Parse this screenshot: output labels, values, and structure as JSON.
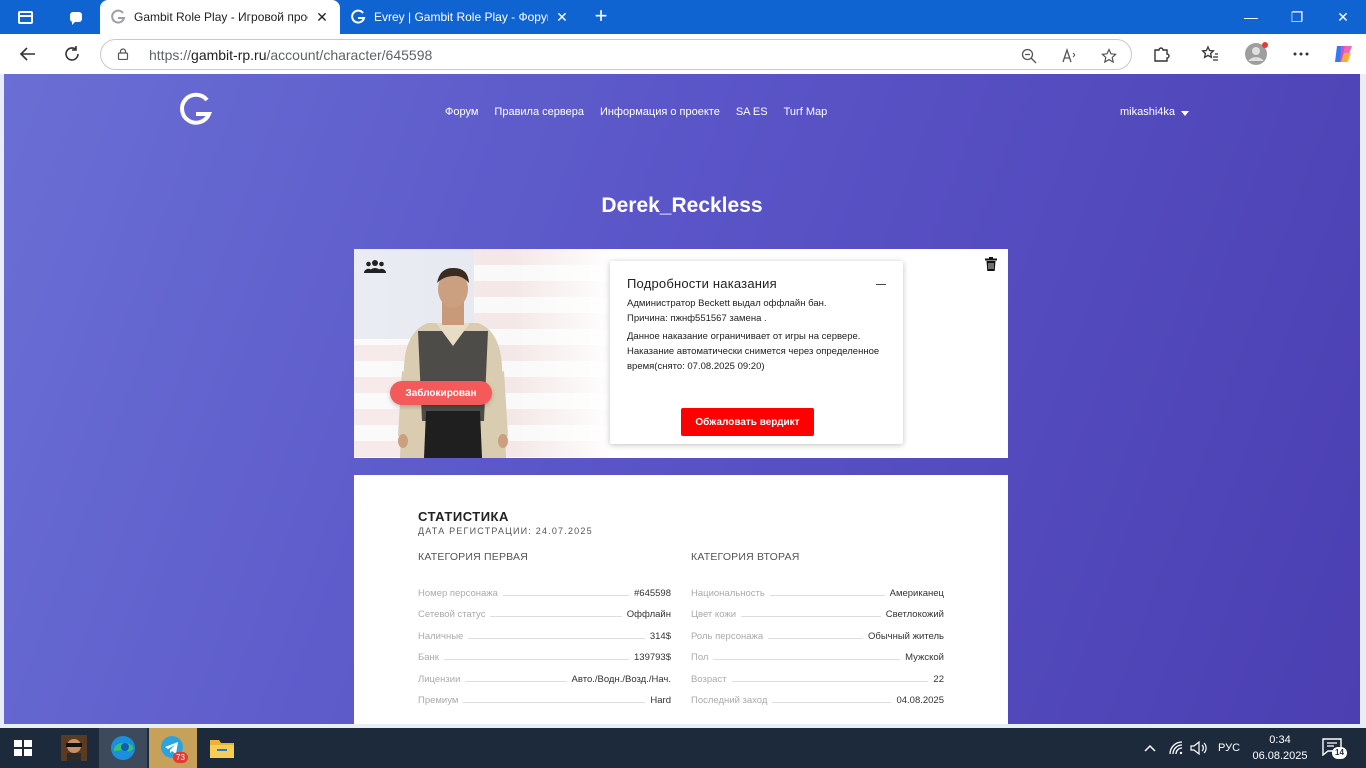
{
  "browser": {
    "tabs": [
      {
        "title": "Gambit Role Play - Игровой проект",
        "active": true
      },
      {
        "title": "Evrey | Gambit Role Play - Форум",
        "active": false
      }
    ],
    "url_prefix": "https://",
    "url_host": "gambit-rp.ru",
    "url_path": "/account/character/645598",
    "window_controls": {
      "minimize": "—",
      "restore": "❐",
      "close": "✕"
    }
  },
  "site": {
    "nav": [
      "Форум",
      "Правила сервера",
      "Информация о проекте",
      "SA ES",
      "Turf Map"
    ],
    "username": "mikashi4ka"
  },
  "character": {
    "name": "Derek_Reckless",
    "status_badge": "Заблокирован"
  },
  "punishment": {
    "title": "Подробности наказания",
    "line1": "Администратор Beckett выдал оффлайн бан.",
    "line2": "Причина: пжнф551567 замена .",
    "line3": "Данное наказание ограничивает от игры на сервере. Наказание автоматически снимется через определенное время(снято: 07.08.2025 09:20)",
    "appeal_label": "Обжаловать вердикт"
  },
  "stats": {
    "title": "СТАТИСТИКА",
    "registration": "ДАТА РЕГИСТРАЦИИ: 24.07.2025",
    "col1": {
      "heading": "КАТЕГОРИЯ ПЕРВАЯ",
      "rows": [
        {
          "label": "Номер персонажа",
          "value": "#645598"
        },
        {
          "label": "Сетевой статус",
          "value": "Оффлайн"
        },
        {
          "label": "Наличные",
          "value": "314$"
        },
        {
          "label": "Банк",
          "value": "139793$"
        },
        {
          "label": "Лицензии",
          "value": "Авто./Водн./Возд./Нач."
        },
        {
          "label": "Премиум",
          "value": "Hard"
        }
      ]
    },
    "col2": {
      "heading": "КАТЕГОРИЯ ВТОРАЯ",
      "rows": [
        {
          "label": "Национальность",
          "value": "Американец"
        },
        {
          "label": "Цвет кожи",
          "value": "Светлокожий"
        },
        {
          "label": "Роль персонажа",
          "value": "Обычный житель"
        },
        {
          "label": "Пол",
          "value": "Мужской"
        },
        {
          "label": "Возраст",
          "value": "22"
        },
        {
          "label": "Последний заход",
          "value": "04.08.2025"
        }
      ]
    }
  },
  "taskbar": {
    "telegram_badge": "73",
    "language": "РУС",
    "time": "0:34",
    "date": "06.08.2025",
    "notifications": "14"
  },
  "colors": {
    "tab_strip": "#0f64d2",
    "page_gradient_start": "#6a6fd4",
    "page_gradient_end": "#4b3fb2",
    "blocked_badge": "#f45a5a",
    "appeal_button": "#ff0000",
    "taskbar": "#1c2a3c"
  }
}
